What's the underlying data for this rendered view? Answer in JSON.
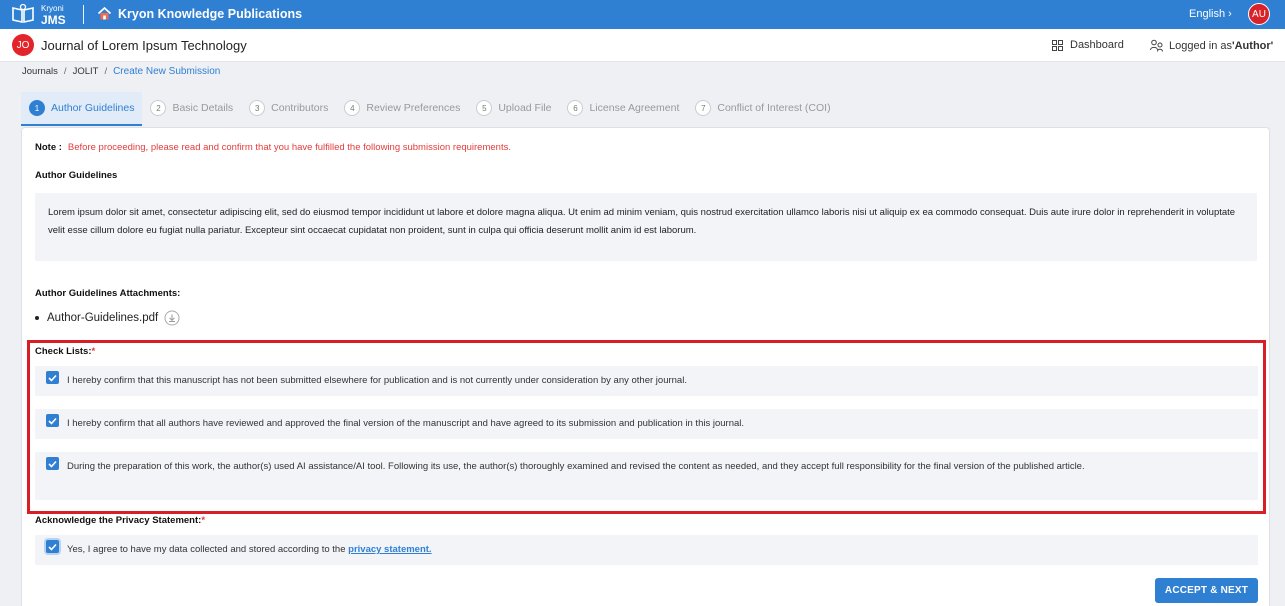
{
  "topbar": {
    "brand_small": "Kryoni",
    "brand_big": "JMS",
    "publisher": "Kryon Knowledge Publications",
    "language": "English",
    "user_initials": "AU"
  },
  "journalbar": {
    "badge": "JO",
    "title": "Journal of Lorem Ipsum Technology",
    "dashboard": "Dashboard",
    "logged_prefix": "Logged in as ",
    "logged_role": "'Author'"
  },
  "breadcrumb": {
    "items": [
      "Journals",
      "JOLIT",
      "Create New Submission"
    ]
  },
  "tabs": [
    {
      "num": "1",
      "label": "Author Guidelines"
    },
    {
      "num": "2",
      "label": "Basic Details"
    },
    {
      "num": "3",
      "label": "Contributors"
    },
    {
      "num": "4",
      "label": "Review Preferences"
    },
    {
      "num": "5",
      "label": "Upload File"
    },
    {
      "num": "6",
      "label": "License Agreement"
    },
    {
      "num": "7",
      "label": "Conflict of Interest (COI)"
    }
  ],
  "content": {
    "note_label": "Note :",
    "note_text": "Before proceeding, please read and confirm that you have fulfilled the following submission requirements.",
    "guidelines_title": "Author Guidelines",
    "guidelines_text": "Lorem ipsum dolor sit amet, consectetur adipiscing elit, sed do eiusmod tempor incididunt ut labore et dolore magna aliqua. Ut enim ad minim veniam, quis nostrud exercitation ullamco laboris nisi ut aliquip ex ea commodo consequat. Duis aute irure dolor in reprehenderit in voluptate velit esse cillum dolore eu fugiat nulla pariatur. Excepteur sint occaecat cupidatat non proident, sunt in culpa qui officia deserunt mollit anim id est laborum.",
    "attachments_title": "Author Guidelines Attachments:",
    "attachment_file": "Author-Guidelines.pdf",
    "checklist_title": "Check Lists:",
    "required_mark": "*",
    "checklist": [
      "I hereby confirm that this manuscript has not been submitted elsewhere for publication and is not currently under consideration by any other journal.",
      "I hereby confirm that all authors have reviewed and approved the final version of the manuscript and have agreed to its submission and publication in this journal.",
      "During the preparation of this work, the author(s) used AI assistance/AI tool. Following its use, the author(s) thoroughly examined and revised the content as needed, and they accept full responsibility for the final version of the published article."
    ],
    "privacy_title": "Acknowledge the Privacy Statement:",
    "privacy_text": "Yes, I agree to have my data collected and stored according to the ",
    "privacy_link": "privacy statement.",
    "accept_button": "ACCEPT & NEXT"
  },
  "colors": {
    "primary": "#2f7fd3",
    "danger": "#d91f26"
  }
}
